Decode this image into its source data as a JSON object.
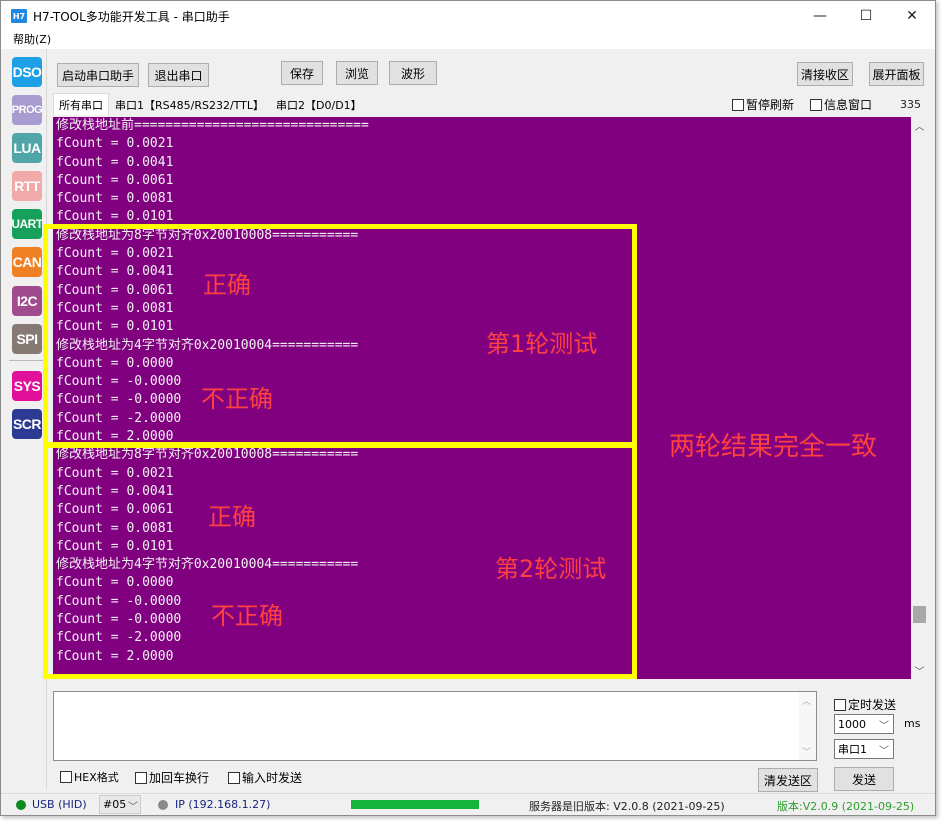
{
  "window": {
    "app_icon_text": "H7",
    "title": "H7-TOOL多功能开发工具 - 串口助手",
    "controls": {
      "minimize": "—",
      "maximize": "☐",
      "close": "✕"
    }
  },
  "menu": {
    "items": [
      {
        "label": "帮助(Z)"
      }
    ]
  },
  "sidebar": {
    "items": [
      {
        "label": "DSO",
        "color": "#1ea0e6"
      },
      {
        "label": "PROG",
        "color": "#a79bd0"
      },
      {
        "label": "LUA",
        "color": "#4fa5a7"
      },
      {
        "label": "RTT",
        "color": "#f2a9aa"
      },
      {
        "label": "UART",
        "color": "#16a05a"
      },
      {
        "label": "CAN",
        "color": "#f08024"
      },
      {
        "label": "I2C",
        "color": "#a04b8e"
      },
      {
        "label": "SPI",
        "color": "#857a74"
      },
      {
        "label": "SYS",
        "color": "#e0109a"
      },
      {
        "label": "SCR",
        "color": "#2c3a93"
      }
    ]
  },
  "toolbar": {
    "start_label": "启动串口助手",
    "exit_label": "退出串口",
    "save_label": "保存",
    "browse_label": "浏览",
    "wave_label": "波形",
    "clear_recv_label": "清接收区",
    "expand_label": "展开面板"
  },
  "tabs": [
    {
      "label": "所有串口",
      "active": true
    },
    {
      "label": "串口1【RS485/RS232/TTL】",
      "active": false
    },
    {
      "label": "串口2【D0/D1】",
      "active": false
    }
  ],
  "options": {
    "pause_refresh": {
      "label": "暂停刷新",
      "checked": false
    },
    "info_window": {
      "label": "信息窗口",
      "checked": false
    },
    "count": "335"
  },
  "terminal": {
    "background": "#800080",
    "lines": [
      "修改栈地址前==============================",
      "fCount = 0.0021",
      "fCount = 0.0041",
      "fCount = 0.0061",
      "fCount = 0.0081",
      "fCount = 0.0101",
      "修改栈地址为8字节对齐0x20010008===========",
      "fCount = 0.0021",
      "fCount = 0.0041",
      "fCount = 0.0061",
      "fCount = 0.0081",
      "fCount = 0.0101",
      "修改栈地址为4字节对齐0x20010004===========",
      "fCount = 0.0000",
      "fCount = -0.0000",
      "fCount = -0.0000",
      "fCount = -2.0000",
      "fCount = 2.0000",
      "修改栈地址为8字节对齐0x20010008===========",
      "fCount = 0.0021",
      "fCount = 0.0041",
      "fCount = 0.0061",
      "fCount = 0.0081",
      "fCount = 0.0101",
      "修改栈地址为4字节对齐0x20010004===========",
      "fCount = 0.0000",
      "fCount = -0.0000",
      "fCount = -0.0000",
      "fCount = -2.0000",
      "fCount = 2.0000"
    ]
  },
  "annotations": {
    "round1_correct": "正确",
    "round1_incorrect": "不正确",
    "round1_label": "第1轮测试",
    "round2_correct": "正确",
    "round2_incorrect": "不正确",
    "round2_label": "第2轮测试",
    "summary": "两轮结果完全一致",
    "highlight_color": "#ffff00",
    "text_color": "#ff4040"
  },
  "send": {
    "input_value": "",
    "hex_format": {
      "label": "HEX格式",
      "checked": false
    },
    "add_crlf": {
      "label": "加回车换行",
      "checked": false
    },
    "send_on_input": {
      "label": "输入时发送",
      "checked": false
    },
    "timed_send": {
      "label": "定时发送",
      "checked": false
    },
    "interval_value": "1000",
    "interval_unit": "ms",
    "port_value": "串口1",
    "clear_send_label": "清发送区",
    "send_label": "发送"
  },
  "statusbar": {
    "usb_label": "USB (HID)",
    "usb_status_color": "#0a8a1e",
    "device_value": "#05",
    "ip_label": "IP (192.168.1.27)",
    "ip_status_color": "#8a8a8a",
    "progress_percent": 100,
    "server_version": "服务器是旧版本: V2.0.8 (2021-09-25)",
    "local_version": "版本:V2.0.9 (2021-09-25)"
  }
}
